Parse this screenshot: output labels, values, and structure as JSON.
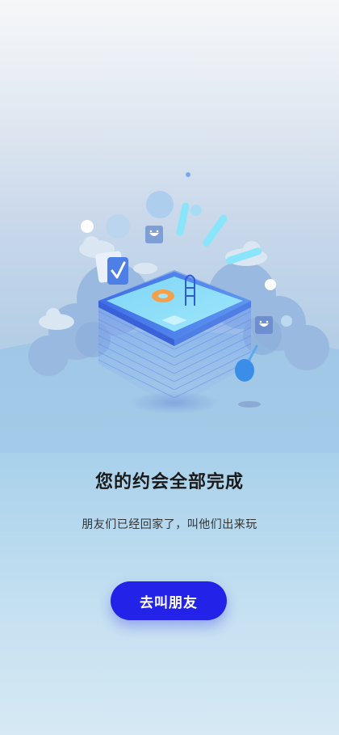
{
  "empty_state": {
    "title": "您的约会全部完成",
    "subtitle": "朋友们已经回家了，叫他们出来玩"
  },
  "actions": {
    "invite_label": "去叫朋友"
  },
  "icons": {
    "illustration": "empty-pool-illustration",
    "checkmark": "checkmark-icon",
    "emoji": "smiley-face-icon"
  },
  "colors": {
    "accent": "#2222e8",
    "title": "#1a1a1a",
    "subtitle": "#333333"
  }
}
